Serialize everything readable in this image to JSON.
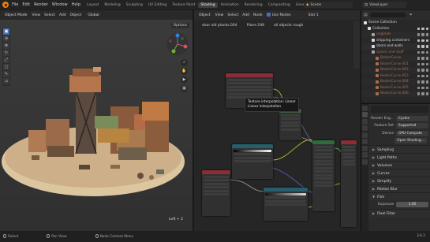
{
  "menu": [
    "File",
    "Edit",
    "Render",
    "Window",
    "Help"
  ],
  "workspace_tabs": [
    {
      "label": "Layout",
      "active": false
    },
    {
      "label": "Modeling",
      "active": false
    },
    {
      "label": "Sculpting",
      "active": false
    },
    {
      "label": "UV Editing",
      "active": false
    },
    {
      "label": "Texture Paint",
      "active": false
    },
    {
      "label": "Shading",
      "active": true
    },
    {
      "label": "Animation",
      "active": false
    },
    {
      "label": "Rendering",
      "active": false
    },
    {
      "label": "Compositing",
      "active": false
    },
    {
      "label": "Geome",
      "active": false
    }
  ],
  "scene_label": "Scene",
  "view_layer_label": "ViewLayer",
  "viewport": {
    "mode": "Object Mode",
    "menus": [
      "View",
      "Select",
      "Add",
      "Object"
    ],
    "transform": "Global",
    "options": "Options",
    "lmb_hint": "Left + 2"
  },
  "node_editor": {
    "type": "Object",
    "menus": [
      "View",
      "Select",
      "Add",
      "Node"
    ],
    "use_nodes": "Use Nodes",
    "slot": "Slot 1",
    "breadcrumbs": [
      "door old planks.004",
      "Plane.198",
      "all objects rough"
    ],
    "tooltip_lines": [
      "Texture interpolation: Linear",
      "Linear interpolation"
    ]
  },
  "outliner": {
    "title": "Scene Collection",
    "items": [
      {
        "label": "Collection",
        "indent": 1,
        "dim": false,
        "color": "#d9d9d9"
      },
      {
        "label": "originals",
        "indent": 2,
        "dim": true,
        "color": "#d9d9d9"
      },
      {
        "label": "shipping containers",
        "indent": 2,
        "dim": false,
        "color": "#d9d9d9"
      },
      {
        "label": "doors and walls",
        "indent": 2,
        "dim": false,
        "color": "#d9d9d9"
      },
      {
        "label": "spares and stuff",
        "indent": 2,
        "dim": true,
        "color": "#d9d9d9"
      },
      {
        "label": "BezierCurve",
        "indent": 3,
        "dim": true,
        "color": "#e08a5b"
      },
      {
        "label": "BezierCurve.001",
        "indent": 3,
        "dim": true,
        "color": "#e08a5b"
      },
      {
        "label": "BezierCurve.002",
        "indent": 3,
        "dim": true,
        "color": "#e08a5b"
      },
      {
        "label": "BezierCurve.003",
        "indent": 3,
        "dim": true,
        "color": "#e08a5b"
      },
      {
        "label": "BezierCurve.004",
        "indent": 3,
        "dim": true,
        "color": "#e08a5b"
      },
      {
        "label": "BezierCurve.005",
        "indent": 3,
        "dim": true,
        "color": "#e08a5b"
      },
      {
        "label": "BezierCurve.006",
        "indent": 3,
        "dim": true,
        "color": "#e08a5b"
      }
    ]
  },
  "properties": {
    "render_engine_label": "Render Eng...",
    "render_engine": "Cycles",
    "feature_set_label": "Feature Set",
    "feature_set": "Supported",
    "device_label": "Device",
    "device": "GPU Compute",
    "open_shading": "Open Shading...",
    "sections": [
      "Sampling",
      "Light Paths",
      "Volumes",
      "Curves",
      "Simplify",
      "Motion Blur",
      "Film"
    ],
    "exposure_label": "Exposure",
    "exposure_value": "1.00",
    "more": "Pixel Filter"
  },
  "status": {
    "items": [
      "Select",
      "Pan View",
      "Node Context Menu"
    ],
    "version": "3.6.2"
  },
  "colors": {
    "accent": "#4772b3",
    "active_tab": "#3e3e3e",
    "node_teal": "#265e6b",
    "node_red": "#8a2d36",
    "node_green": "#2f6b3b",
    "blender_orange": "#e87d0d"
  }
}
